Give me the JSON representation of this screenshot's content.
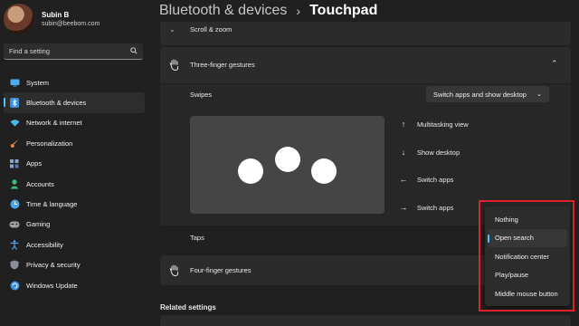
{
  "profile": {
    "name": "Subin B",
    "email": "subin@beebom.com"
  },
  "search": {
    "placeholder": "Find a setting"
  },
  "nav": [
    {
      "label": "System",
      "icon": "monitor-icon",
      "color": "#4fa8e8"
    },
    {
      "label": "Bluetooth & devices",
      "icon": "bluetooth-icon",
      "color": "#3a8fe0"
    },
    {
      "label": "Network & internet",
      "icon": "wifi-icon",
      "color": "#4fb6ea"
    },
    {
      "label": "Personalization",
      "icon": "brush-icon",
      "color": "#e0884a"
    },
    {
      "label": "Apps",
      "icon": "apps-icon",
      "color": "#8aa4c8"
    },
    {
      "label": "Accounts",
      "icon": "account-icon",
      "color": "#3fbf7a"
    },
    {
      "label": "Time & language",
      "icon": "globe-clock-icon",
      "color": "#4aa8e8"
    },
    {
      "label": "Gaming",
      "icon": "gamepad-icon",
      "color": "#9aa0a8"
    },
    {
      "label": "Accessibility",
      "icon": "accessibility-icon",
      "color": "#4fa0e8"
    },
    {
      "label": "Privacy & security",
      "icon": "shield-icon",
      "color": "#8a8f98"
    },
    {
      "label": "Windows Update",
      "icon": "update-icon",
      "color": "#3a8fe0"
    }
  ],
  "header": {
    "parent": "Bluetooth & devices",
    "separator": "›",
    "current": "Touchpad"
  },
  "sections": {
    "scroll_zoom": "Scroll & zoom",
    "three_finger": "Three-finger gestures",
    "swipes_label": "Swipes",
    "swipes_value": "Switch apps and show desktop",
    "taps_label": "Taps",
    "four_finger": "Four-finger gestures",
    "related": "Related settings"
  },
  "swipe_options": [
    {
      "arrow": "↑",
      "label": "Multitasking view"
    },
    {
      "arrow": "↓",
      "label": "Show desktop"
    },
    {
      "arrow": "←",
      "label": "Switch apps"
    },
    {
      "arrow": "→",
      "label": "Switch apps"
    }
  ],
  "taps_menu": {
    "items": [
      "Nothing",
      "Open search",
      "Notification center",
      "Play/pause",
      "Middle mouse button"
    ],
    "selected": "Open search"
  },
  "colors": {
    "accent": "#4cc2ff",
    "highlight": "#e0202a"
  }
}
